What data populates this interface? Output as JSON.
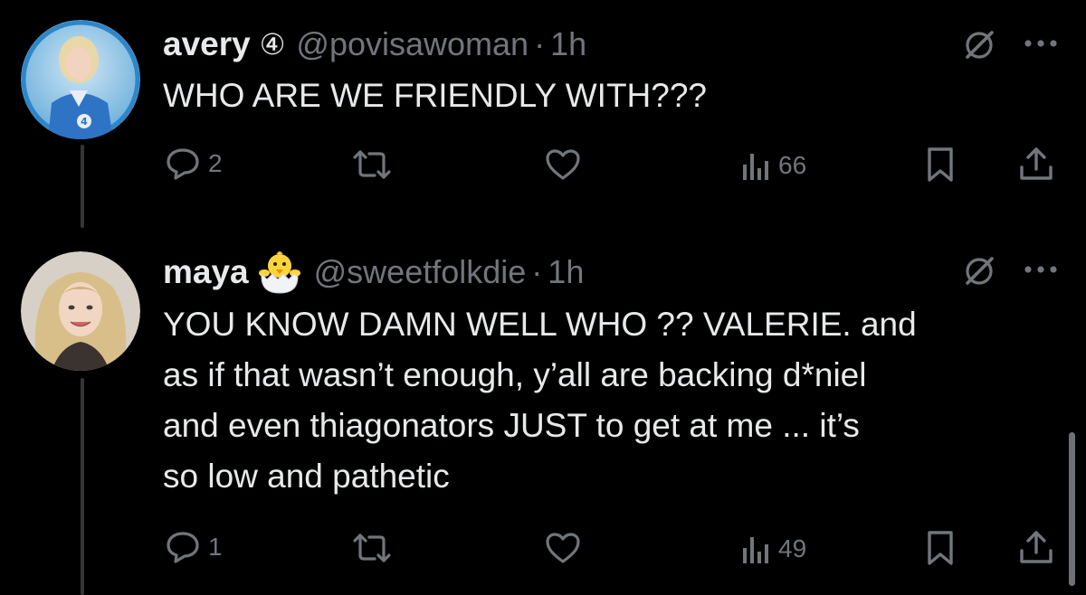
{
  "colors": {
    "background": "#000000",
    "text_primary": "#e7e9ea",
    "text_secondary": "#71767b",
    "thread_line": "#333639"
  },
  "tweets": [
    {
      "display_name": "avery",
      "badge": "④",
      "handle": "@povisawoman",
      "separator": "·",
      "time": "1h",
      "text": "WHO ARE WE FRIENDLY WITH???",
      "avatar_icon": "avatar-avery",
      "stats": {
        "replies": "2",
        "views": "66"
      }
    },
    {
      "display_name": "maya",
      "emoji_icon": "hatching-chick-icon",
      "handle": "@sweetfolkdie",
      "separator": "·",
      "time": "1h",
      "text": "YOU KNOW DAMN WELL WHO ?? VALERIE. and\nas if that wasn’t enough, y’all are backing d*niel\nand even thiagonators JUST to get at me ... it’s\nso low and pathetic",
      "avatar_icon": "avatar-maya",
      "stats": {
        "replies": "1",
        "views": "49"
      }
    }
  ],
  "icons": {
    "reply": "reply-icon",
    "repost": "repost-icon",
    "like": "like-icon",
    "views": "views-icon",
    "bookmark": "bookmark-icon",
    "share": "share-icon",
    "grok": "grok-icon",
    "more": "more-icon"
  }
}
